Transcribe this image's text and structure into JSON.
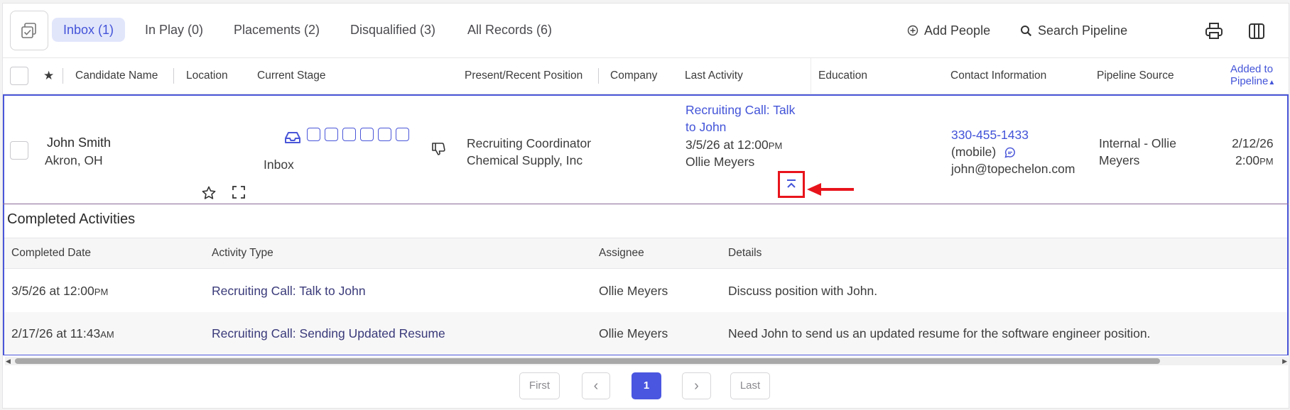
{
  "tabs": [
    {
      "label": "Inbox (1)"
    },
    {
      "label": "In Play (0)"
    },
    {
      "label": "Placements (2)"
    },
    {
      "label": "Disqualified (3)"
    },
    {
      "label": "All Records (6)"
    }
  ],
  "toolbar": {
    "add_people": "Add People",
    "search_pipeline": "Search Pipeline"
  },
  "columns": {
    "star": "★",
    "candidate_name": "Candidate Name",
    "location": "Location",
    "current_stage": "Current Stage",
    "position": "Present/Recent Position",
    "company": "Company",
    "last_activity": "Last Activity",
    "education": "Education",
    "contact": "Contact Information",
    "pipeline_source": "Pipeline Source",
    "added_line1": "Added to",
    "added_line2": "Pipeline"
  },
  "candidate": {
    "name": "John Smith",
    "location": "Akron, OH",
    "stage": "Inbox",
    "position": "Recruiting Coordinator",
    "company": "Chemical Supply, Inc",
    "activity_line1": "Recruiting Call: Talk",
    "activity_line2": "to John",
    "activity_date": "3/5/26 at 12:00",
    "activity_ampm": "PM",
    "activity_user": "Ollie Meyers",
    "phone": "330-455-1433",
    "phone_type": "(mobile)",
    "email": "john@topechelon.com",
    "source_line1": "Internal - Ollie",
    "source_line2": "Meyers",
    "added_date": "2/12/26",
    "added_time": "2:00",
    "added_ampm": "PM"
  },
  "activities": {
    "title": "Completed Activities",
    "headers": {
      "date": "Completed Date",
      "type": "Activity Type",
      "assignee": "Assignee",
      "details": "Details"
    },
    "rows": [
      {
        "date": "3/5/26 at 12:00",
        "ampm": "PM",
        "type": "Recruiting Call: Talk to John",
        "assignee": "Ollie Meyers",
        "details": "Discuss position with John."
      },
      {
        "date": "2/17/26 at 11:43",
        "ampm": "AM",
        "type": "Recruiting Call: Sending Updated Resume",
        "assignee": "Ollie Meyers",
        "details": "Need John to send us an updated resume for the software engineer position."
      }
    ]
  },
  "pagination": {
    "first": "First",
    "prev": "‹",
    "current": "1",
    "next": "›",
    "last": "Last"
  },
  "colors": {
    "accent": "#4354d8",
    "highlight": "#e8141c",
    "active_tab_bg": "#e2e6fb"
  }
}
